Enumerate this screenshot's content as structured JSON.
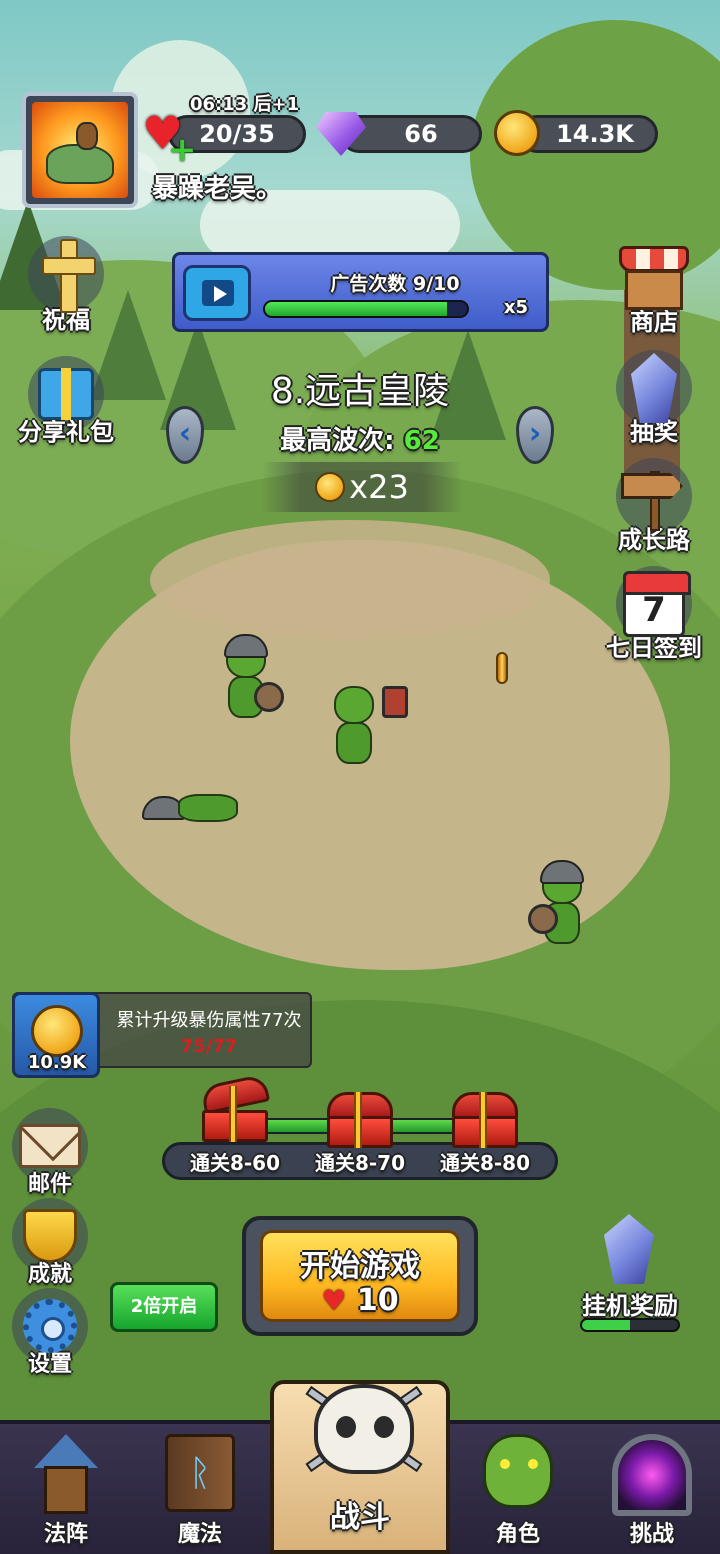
{
  "player": {
    "name": "暴躁老吴。",
    "energy_timer": "06:13 后+1",
    "energy": "20/35",
    "gems": "66",
    "coins": "14.3K"
  },
  "left_menu": [
    {
      "label": "祝福",
      "icon": "cross-icon"
    },
    {
      "label": "分享礼包",
      "icon": "gift-icon"
    }
  ],
  "right_menu": [
    {
      "label": "商店",
      "icon": "shop-icon"
    },
    {
      "label": "抽奖",
      "icon": "crystal-icon"
    },
    {
      "label": "成长路",
      "icon": "signpost-icon"
    },
    {
      "label": "七日签到",
      "icon": "calendar-icon",
      "calendar_number": "7"
    }
  ],
  "ad": {
    "label": "广告次数 9/10",
    "progress": 0.9,
    "multiplier": "x5"
  },
  "stage": {
    "title": "8.远古皇陵",
    "best_wave_label": "最高波次:",
    "best_wave": "62",
    "reward": "x23"
  },
  "quest": {
    "reward_amount": "10.9K",
    "text": "累计升级暴伤属性77次",
    "progress": "75/77"
  },
  "chests": [
    {
      "label": "通关8-60",
      "opened": true
    },
    {
      "label": "通关8-70",
      "opened": false
    },
    {
      "label": "通关8-80",
      "opened": false
    }
  ],
  "bottom_left": [
    {
      "label": "邮件",
      "icon": "mail-icon"
    },
    {
      "label": "成就",
      "icon": "trophy-icon"
    },
    {
      "label": "设置",
      "icon": "gear-icon"
    }
  ],
  "start_button": {
    "title": "开始游戏",
    "cost": "10"
  },
  "double_button": "2倍开启",
  "idle": {
    "label": "挂机奖励",
    "progress": 0.5
  },
  "nav": [
    {
      "label": "法阵",
      "icon": "tower-icon"
    },
    {
      "label": "魔法",
      "icon": "spellbook-icon"
    },
    {
      "label": "战斗",
      "icon": "skull-icon",
      "active": true
    },
    {
      "label": "角色",
      "icon": "orc-face-icon"
    },
    {
      "label": "挑战",
      "icon": "portal-icon"
    }
  ],
  "colors": {
    "wave_number": "#57ec3a",
    "quest_progress": "#d81e1e",
    "ad_bar": "#3f5cc9",
    "start_button": "#ffb821"
  }
}
